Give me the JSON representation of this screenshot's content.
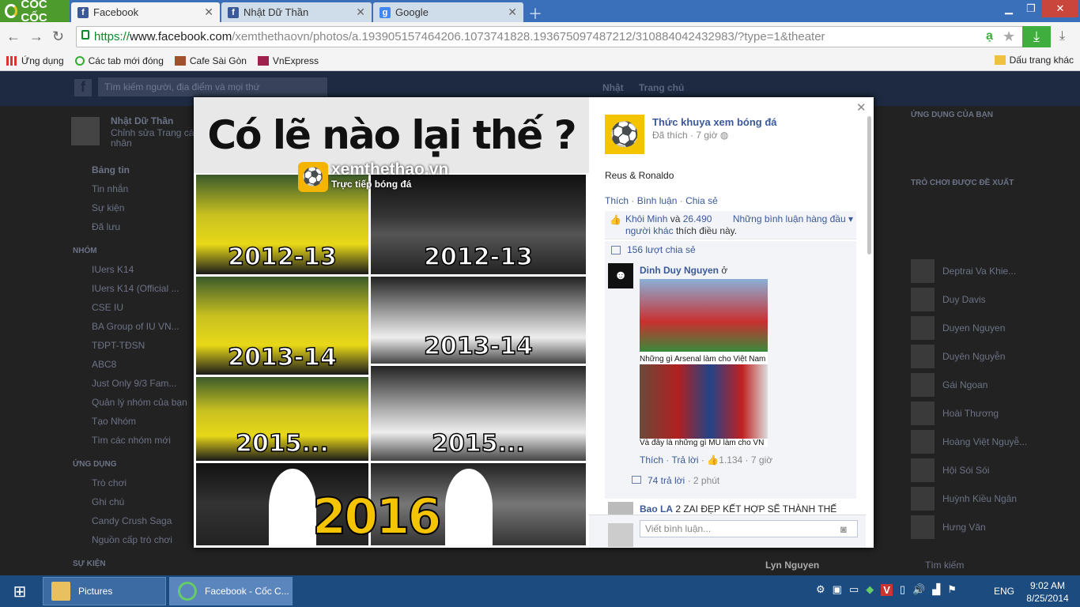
{
  "browser": {
    "brand": "CỐC CỐC",
    "tabs": [
      {
        "label": "Facebook",
        "active": true,
        "icon": "facebook-icon"
      },
      {
        "label": "Nhật Dữ Thần",
        "active": false,
        "icon": "facebook-icon"
      },
      {
        "label": "Google",
        "active": false,
        "icon": "google-icon"
      }
    ],
    "url_scheme": "https://",
    "url_host": "www.facebook.com",
    "url_path": "/xemthethaovn/photos/a.193905157464206.1073741828.193675097487212/310884042432983/?type=1&theater",
    "bookmarks": [
      "Ứng dụng",
      "Các tab mới đóng",
      "Cafe Sài Gòn",
      "VnExpress"
    ],
    "bookmarks_other": "Dấu trang khác"
  },
  "fb": {
    "search_placeholder": "Tìm kiếm người, địa điểm và mọi thứ",
    "top_user": "Nhật",
    "top_home": "Trang chủ",
    "left": {
      "profile_name": "Nhật Dữ Thần",
      "profile_edit": "Chỉnh sửa Trang cá nhân",
      "items": [
        "Bảng tin",
        "Tin nhắn",
        "Sự kiện",
        "Đã lưu",
        "NHÓM",
        "IUers K14",
        "IUers K14 (Official ...",
        "CSE IU",
        "BA Group of IU VN...",
        "TĐPT-TĐSN",
        "ABC8",
        "Just Only 9/3 Fam...",
        "Quản lý nhóm của bạn",
        "Tạo Nhóm",
        "Tìm các nhóm mới",
        "ỨNG DỤNG",
        "Trò chơi",
        "Ghi chú",
        "Candy Crush Saga",
        "Nguồn cấp trò chơi",
        "SỰ KIỆN"
      ]
    },
    "right": {
      "heading1": "ỨNG DỤNG CỦA BẠN",
      "heading2": "TRÒ CHƠI ĐƯỢC ĐỀ XUẤT",
      "friends": [
        "Deptrai Va Khie...",
        "Duy Davis",
        "Duyen Nguyen",
        "Duyên Nguyễn",
        "Gái Ngoan",
        "Hoài Thương",
        "Hoàng Việt Nguyễ...",
        "Hội Sói Sói",
        "Huỳnh Kiều Ngân",
        "Hưng Văn",
        "Lyn Nguyen"
      ],
      "search_placeholder": "Tìm kiếm"
    }
  },
  "photo": {
    "headline": "Có lẽ nào lại thế ?",
    "watermark_site": "xemthethao.vn",
    "watermark_tag": "Trực tiếp bóng đá",
    "left_labels": [
      "2012-13",
      "2013-14",
      "2015..."
    ],
    "right_labels": [
      "2012-13",
      "2013-14",
      "2015..."
    ],
    "final_year": "2016"
  },
  "post": {
    "page_name": "Thức khuya xem bóng đá",
    "meta": "Đã thích · 7 giờ",
    "text": "Reus & Ronaldo",
    "action_like": "Thích",
    "action_comment": "Bình luận",
    "action_share": "Chia sẻ",
    "likes_user": "Khôi Minh",
    "likes_and": "và",
    "likes_count": "26.490",
    "likes_others": "người khác",
    "likes_suffix": "thích điều này.",
    "sort_label": "Những bình luận hàng đầu",
    "shares": "156 lượt chia sẻ",
    "comment1": {
      "name": "Dinh Duy Nguyen",
      "suffix": "ở",
      "caption1": "Những gì Arsenal làm cho Việt Nam",
      "caption2": "Và đây là những gì MU làm cho VN",
      "like": "Thích",
      "reply": "Trả lời",
      "likes": "1.134",
      "time": "7 giờ",
      "replies": "74 trả lời",
      "replies_time": "2 phút"
    },
    "comment2": {
      "name": "Bao LA",
      "text": "2 ZAI ĐẸP KẾT HỢP SẼ THÀNH THẾ"
    },
    "write_placeholder": "Viết bình luận..."
  },
  "taskbar": {
    "items": [
      "Pictures",
      "Facebook - Cốc C..."
    ],
    "lang": "ENG",
    "time": "9:02 AM",
    "date": "8/25/2014"
  },
  "colors": {
    "fb_blue": "#3b5998",
    "taskbar": "#1c4b80",
    "coccoc_green": "#4c9b2c"
  }
}
